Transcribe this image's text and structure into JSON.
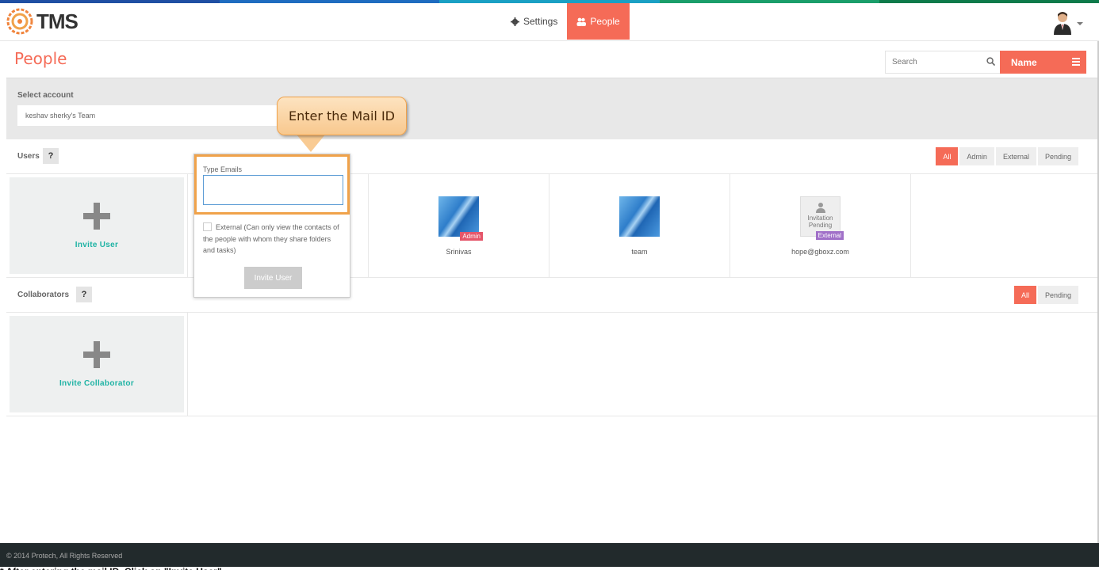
{
  "colors": {
    "accent": "#f56b57",
    "teal": "#1eb3a4",
    "callout": "#f8c88e",
    "stripe": [
      "#1f4fa3",
      "#1e6cc0",
      "#1aa0c4",
      "#1a9e6a",
      "#0d7a4a"
    ]
  },
  "header": {
    "logo_text": "TMS",
    "nav": [
      {
        "label": "Settings",
        "icon": "gear-icon",
        "active": false
      },
      {
        "label": "People",
        "icon": "people-icon",
        "active": true
      }
    ]
  },
  "page": {
    "title": "People",
    "search_placeholder": "Search",
    "sort_label": "Name"
  },
  "account": {
    "label": "Select account",
    "value": "keshav sherky's Team"
  },
  "users": {
    "label": "Users",
    "help": "?",
    "filters": [
      "All",
      "Admin",
      "External",
      "Pending"
    ],
    "invite_label": "Invite User",
    "list": [
      {
        "name": "Srinivas",
        "badge": "Admin"
      },
      {
        "name": "team",
        "badge": ""
      },
      {
        "name": "hope@gboxz.com",
        "badge": "External",
        "placeholder": "Invitation Pending"
      }
    ]
  },
  "collaborators": {
    "label": "Collaborators",
    "help": "?",
    "filters": [
      "All",
      "Pending"
    ],
    "invite_label": "Invite Collaborator"
  },
  "popup": {
    "emails_label": "Type Emails",
    "emails_value": "",
    "external_text": "External (Can only view the contacts of the people with whom they share folders and tasks)",
    "button_label": "Invite User"
  },
  "callout": "Enter the Mail ID",
  "footer": "© 2014 Protech, All Rights Reserved",
  "footnote": "* After entering the mail ID, Click on \"Invite User\"."
}
